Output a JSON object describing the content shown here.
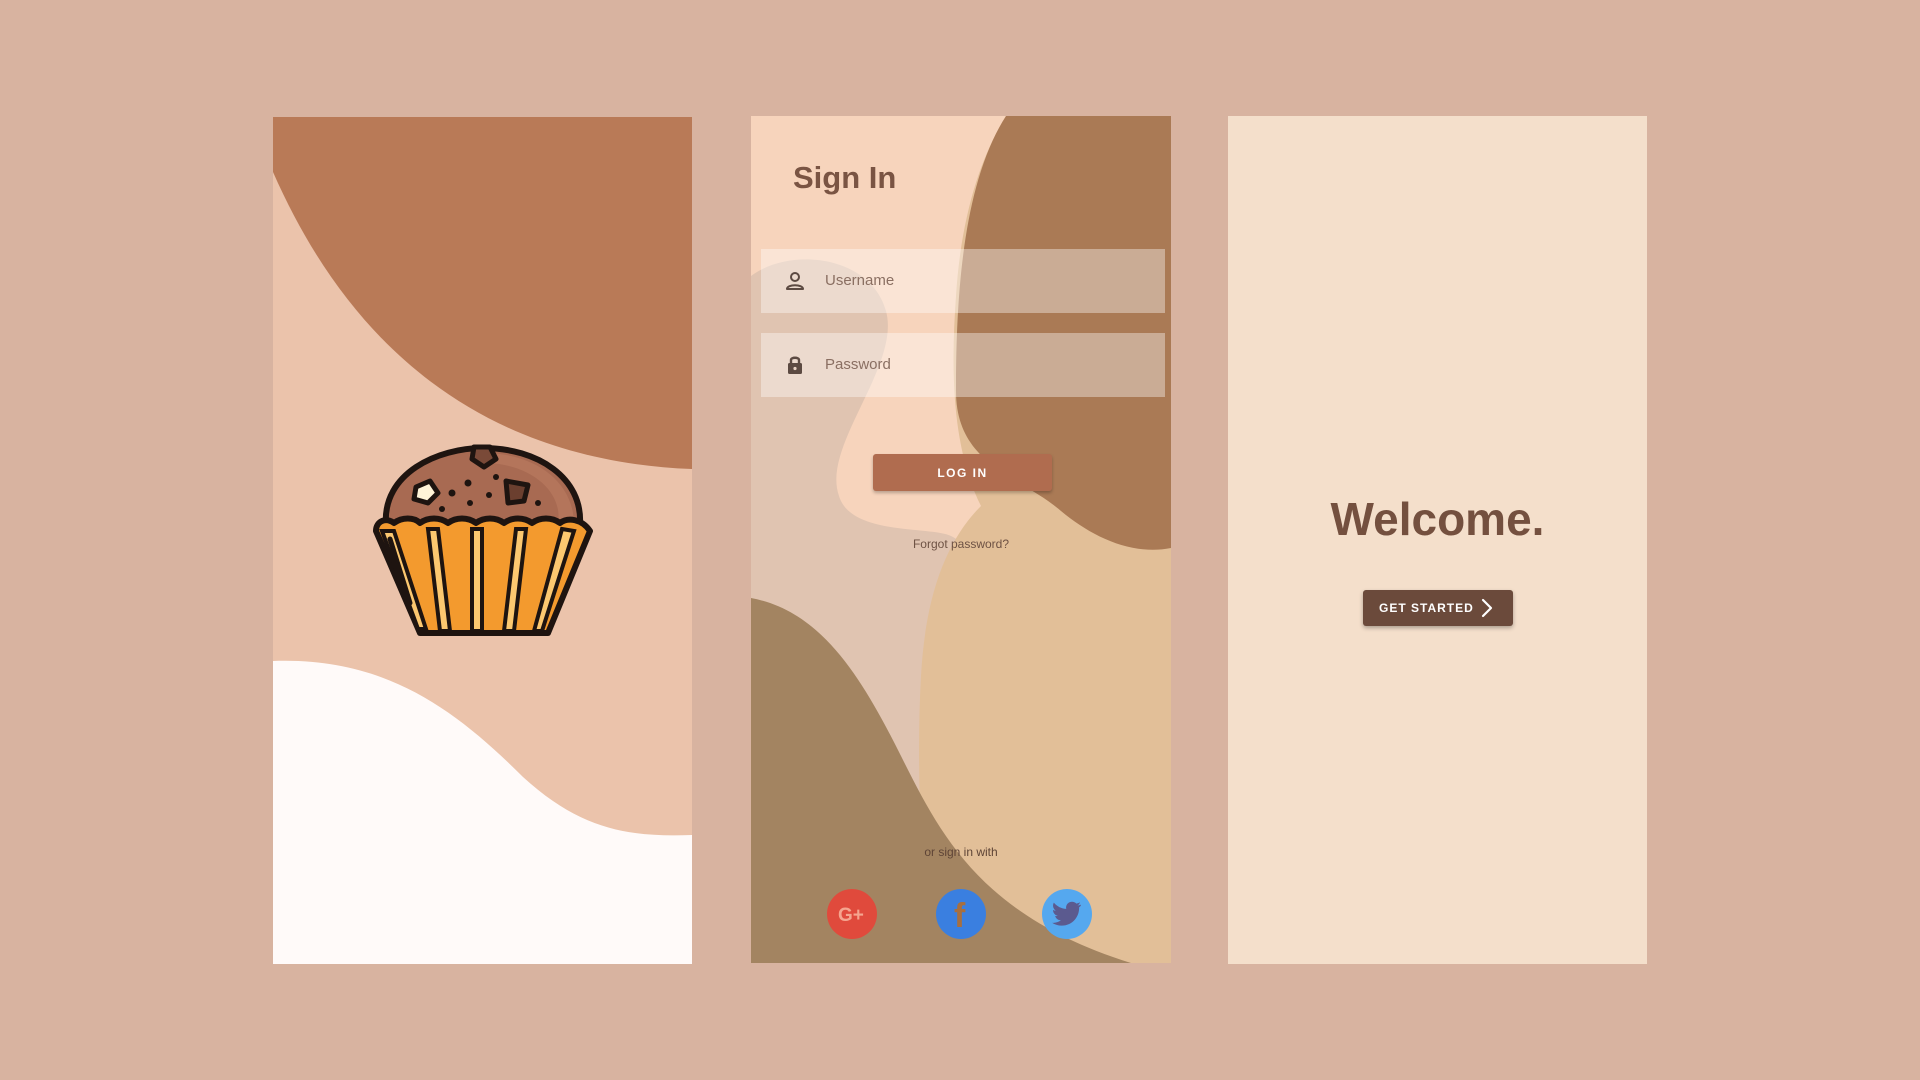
{
  "colors": {
    "page_bg": "#d8b3a0",
    "accent_brown": "#b06c4f",
    "dark_brown": "#6b4a3b",
    "google": "#e04a3c",
    "facebook": "#3a7fe0",
    "twitter": "#55a8ef"
  },
  "splash": {
    "logo_icon": "cupcake-muffin-icon"
  },
  "signin": {
    "title": "Sign In",
    "username": {
      "placeholder": "Username",
      "value": "",
      "icon": "user-icon"
    },
    "password": {
      "placeholder": "Password",
      "value": "",
      "icon": "lock-icon"
    },
    "login_label": "LOG IN",
    "forgot_label": "Forgot password?",
    "social_label": "or sign in with",
    "social": {
      "google": {
        "glyph": "G+",
        "icon": "google-plus-icon"
      },
      "facebook": {
        "glyph": "f",
        "icon": "facebook-icon"
      },
      "twitter": {
        "icon": "twitter-bird-icon"
      }
    }
  },
  "welcome": {
    "title": "Welcome.",
    "start_label": "GET STARTED",
    "start_icon": "chevron-right-icon"
  }
}
